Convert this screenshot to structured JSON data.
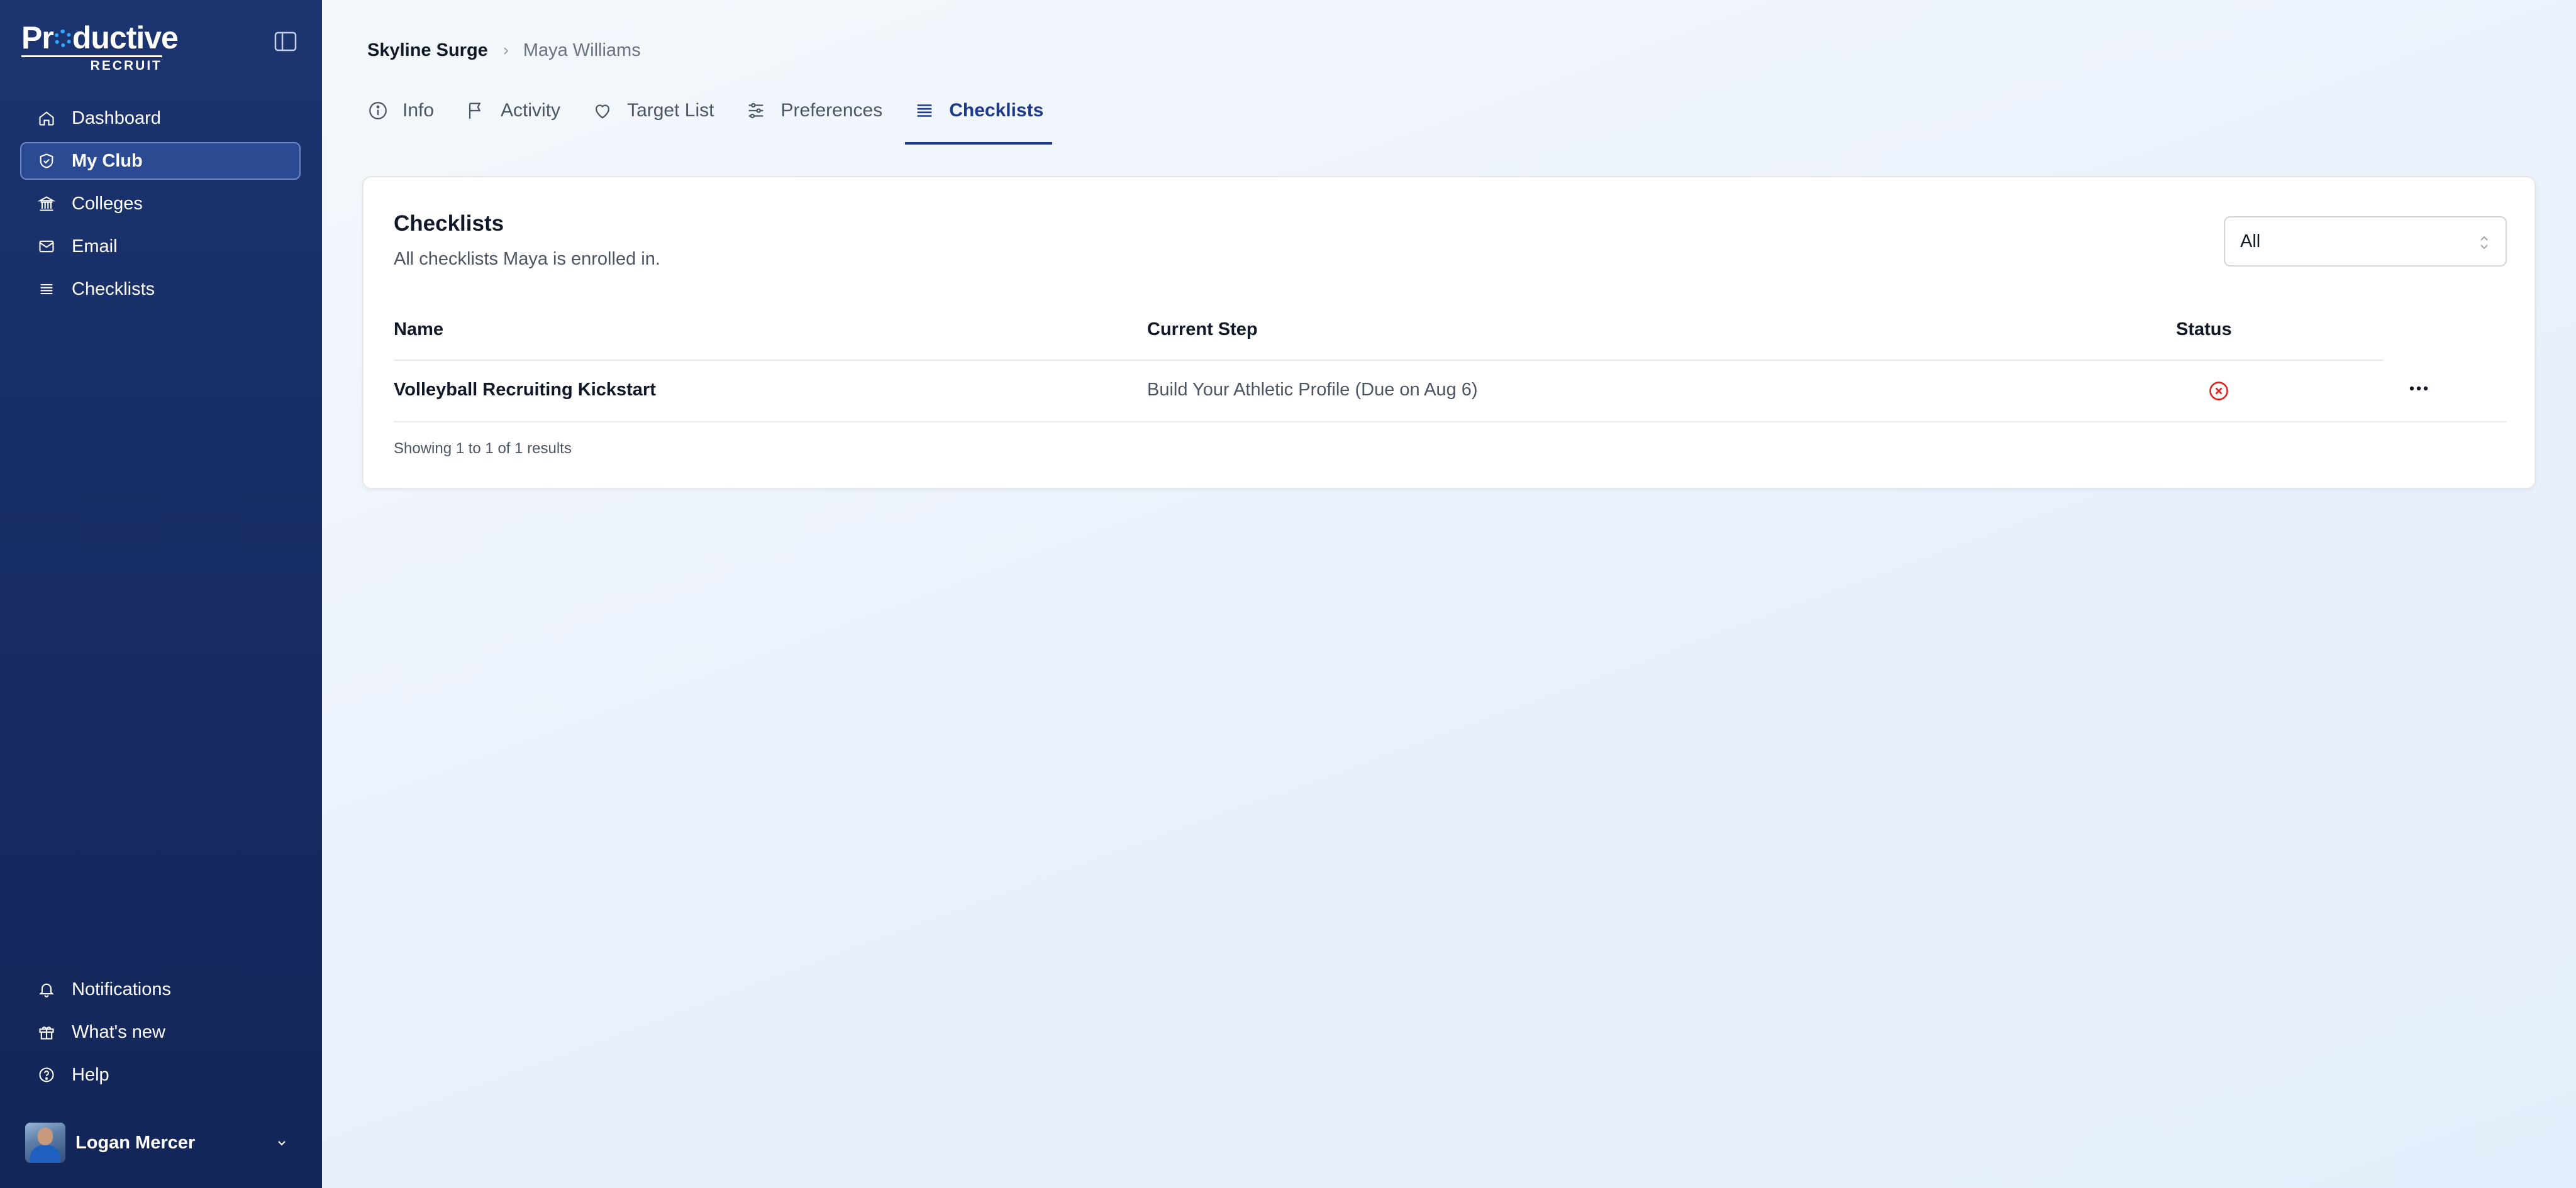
{
  "brand": {
    "name": "Productive",
    "sub": "RECRUIT",
    "accent": "#2fa8ff",
    "sidebar_bg": "#1c3470"
  },
  "sidebar": {
    "items": [
      {
        "label": "Dashboard",
        "icon": "home-icon",
        "active": false
      },
      {
        "label": "My Club",
        "icon": "shield-icon",
        "active": true
      },
      {
        "label": "Colleges",
        "icon": "building-icon",
        "active": false
      },
      {
        "label": "Email",
        "icon": "mail-icon",
        "active": false
      },
      {
        "label": "Checklists",
        "icon": "list-icon",
        "active": false
      }
    ],
    "bottom_items": [
      {
        "label": "Notifications",
        "icon": "bell-icon"
      },
      {
        "label": "What's new",
        "icon": "gift-icon"
      },
      {
        "label": "Help",
        "icon": "help-icon"
      }
    ],
    "user": {
      "name": "Logan Mercer"
    }
  },
  "breadcrumb": {
    "club": "Skyline Surge",
    "athlete": "Maya Williams"
  },
  "tabs": [
    {
      "label": "Info",
      "icon": "info-icon",
      "active": false
    },
    {
      "label": "Activity",
      "icon": "flag-icon",
      "active": false
    },
    {
      "label": "Target List",
      "icon": "heart-icon",
      "active": false
    },
    {
      "label": "Preferences",
      "icon": "sliders-icon",
      "active": false
    },
    {
      "label": "Checklists",
      "icon": "list-icon",
      "active": true
    }
  ],
  "card": {
    "title": "Checklists",
    "subtitle": "All checklists Maya is enrolled in.",
    "filter": {
      "value": "All"
    },
    "columns": {
      "name": "Name",
      "step": "Current Step",
      "status": "Status"
    },
    "rows": [
      {
        "name": "Volleyball Recruiting Kickstart",
        "step": "Build Your Athletic Profile (Due on Aug 6)",
        "status": "incomplete",
        "status_color": "#dc2626"
      }
    ],
    "footer": "Showing 1 to 1 of 1 results"
  }
}
